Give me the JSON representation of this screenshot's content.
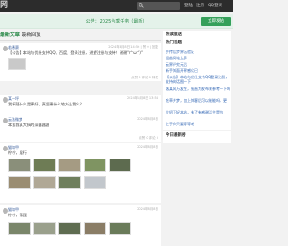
{
  "header": {
    "logo": "网",
    "search_placeholder": "",
    "nav": [
      "登陆",
      "注册",
      "QQ登录"
    ]
  },
  "notice": {
    "text": "公告：2025合季任务（最新）",
    "post_button": "立即发帖"
  },
  "tabs": {
    "active": "最新文章",
    "other": "最新回复"
  },
  "posts": [
    {
      "user": "若愚赛",
      "time": "2024年8月8日 14:56 | 赞 0 | 回复",
      "text": "【公告】本站与优仕支持QQ、百度、登录注册，进望注册与支持！谢谢\"(^ω^)\"",
      "links": "点赞 0  评论 0  转发"
    },
    {
      "user": "某一坪",
      "time": "2024年8月8日 13:54",
      "text": "我怀疑什么是事好，真里更什么地方让我么？",
      "links": "点赞 0  评论 0"
    },
    {
      "user": "云法微梦",
      "time": "2024年8月8日",
      "text": "本法我真大搞的深器器器",
      "links": "点赞 0  评论 0"
    },
    {
      "user": "猫和甲",
      "time": "2024年8月8日",
      "text": "柠柠，展行",
      "links": ""
    },
    {
      "user": "猫和甲",
      "time": "2024年8月8日",
      "text": "柠柠，落昆",
      "links": ""
    }
  ],
  "sidebar": {
    "section1": "热读推送",
    "section2": "热门话题",
    "links": [
      "手传后步界坛验证",
      "迎些网站上手",
      "云界评究元后",
      "新手知面开界感化已",
      "【公告】本站与优仕支持QQ登录注册，支持的话图一下",
      "落某网万友在，殖直为发布来参考一下吗",
      "吃草并梦，加上博客后可以能能吗，更",
      "介绍下好本站，有了有感谢活主是内",
      "上手你只要等等吧"
    ],
    "section3": "今日最新榜"
  },
  "colors": {
    "accent": "#35a05a",
    "topbar": "#2c2c2c",
    "link": "#2f64b3"
  }
}
